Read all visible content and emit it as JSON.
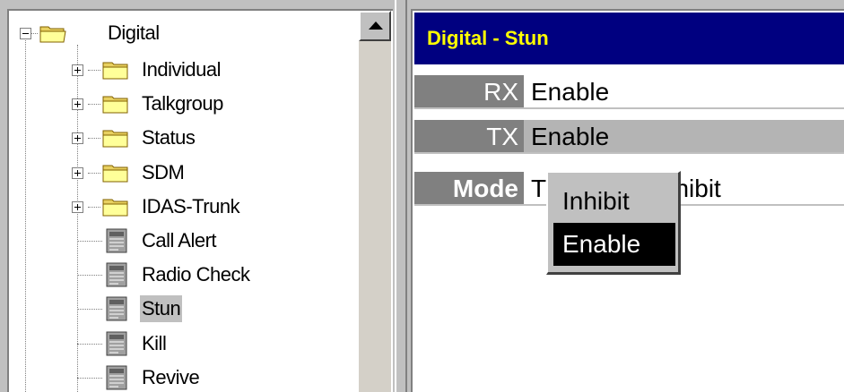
{
  "tree": {
    "root": {
      "label": "Digital",
      "icon": "folder-open-icon"
    },
    "items": [
      {
        "label": "Individual",
        "icon": "folder-icon",
        "expandable": true
      },
      {
        "label": "Talkgroup",
        "icon": "folder-icon",
        "expandable": true
      },
      {
        "label": "Status",
        "icon": "folder-icon",
        "expandable": true
      },
      {
        "label": "SDM",
        "icon": "folder-icon",
        "expandable": true
      },
      {
        "label": "IDAS-Trunk",
        "icon": "folder-icon",
        "expandable": true
      },
      {
        "label": "Call Alert",
        "icon": "document-icon",
        "expandable": false
      },
      {
        "label": "Radio Check",
        "icon": "document-icon",
        "expandable": false
      },
      {
        "label": "Stun",
        "icon": "document-icon",
        "expandable": false,
        "selected": true
      },
      {
        "label": "Kill",
        "icon": "document-icon",
        "expandable": false
      },
      {
        "label": "Revive",
        "icon": "document-icon",
        "expandable": false
      }
    ]
  },
  "panel": {
    "title": "Digital - Stun",
    "properties": [
      {
        "name": "RX",
        "value": "Enable"
      },
      {
        "name": "TX",
        "value": "Enable"
      },
      {
        "name": "Mode",
        "value": "Inhibit",
        "value_prefix": "T"
      }
    ]
  },
  "dropdown": {
    "options": [
      "Inhibit",
      "Enable"
    ],
    "highlighted": "Enable"
  },
  "colors": {
    "title_bg": "#000080",
    "title_fg": "#ffff00",
    "label_bg": "#808080",
    "highlight_bg": "#000000"
  }
}
